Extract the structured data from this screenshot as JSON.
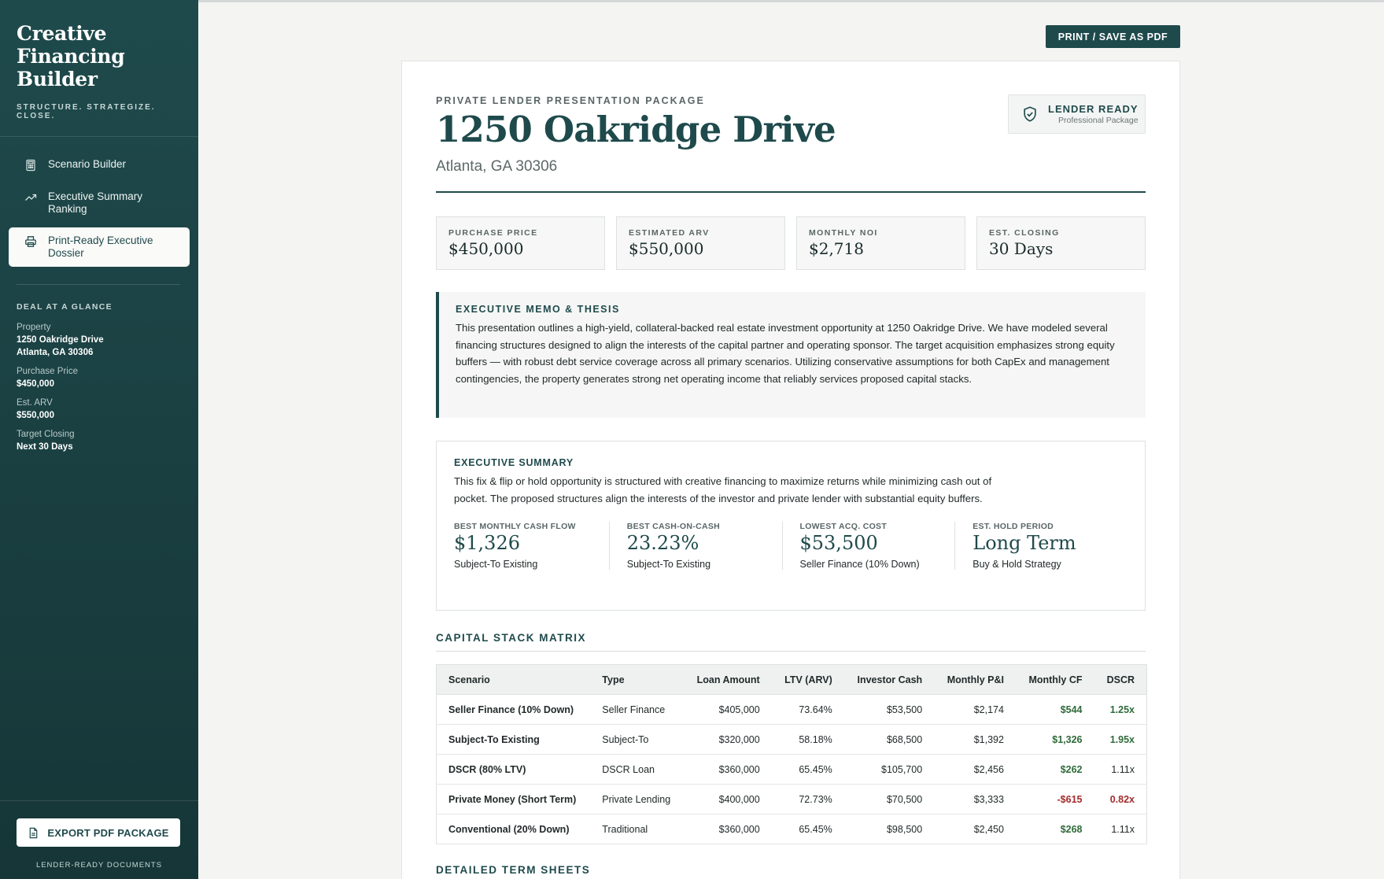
{
  "sidebar": {
    "brand_title": "Creative\nFinancing\nBuilder",
    "brand_tagline": "STRUCTURE. STRATEGIZE. CLOSE.",
    "nav": [
      {
        "label": "Scenario Builder",
        "icon": "calculator-icon"
      },
      {
        "label": "Executive Summary Ranking",
        "icon": "trending-up-icon"
      },
      {
        "label": "Print-Ready Executive Dossier",
        "icon": "printer-icon",
        "active": true
      }
    ],
    "glance_title": "DEAL AT A GLANCE",
    "glance": {
      "property_label": "Property",
      "property_line1": "1250 Oakridge Drive",
      "property_line2": "Atlanta, GA 30306",
      "price_label": "Purchase Price",
      "price_value": "$450,000",
      "arv_label": "Est. ARV",
      "arv_value": "$550,000",
      "closing_label": "Target Closing",
      "closing_value": "Next 30 Days"
    },
    "export_label": "EXPORT PDF PACKAGE",
    "footer_tag": "LENDER-READY DOCUMENTS"
  },
  "toolbar": {
    "print_label": "PRINT / SAVE AS PDF"
  },
  "header": {
    "eyebrow": "PRIVATE LENDER PRESENTATION PACKAGE",
    "title": "1250 Oakridge Drive",
    "subtitle": "Atlanta, GA 30306",
    "badge_title": "LENDER READY",
    "badge_sub": "Professional Package"
  },
  "stats": [
    {
      "label": "PURCHASE PRICE",
      "value": "$450,000"
    },
    {
      "label": "ESTIMATED ARV",
      "value": "$550,000"
    },
    {
      "label": "MONTHLY NOI",
      "value": "$2,718"
    },
    {
      "label": "EST. CLOSING",
      "value": "30 Days"
    }
  ],
  "memo": {
    "title": "EXECUTIVE MEMO & THESIS",
    "body": "This presentation outlines a high-yield, collateral-backed real estate investment opportunity at 1250 Oakridge Drive. We have modeled several financing structures designed to align the interests of the capital partner and operating sponsor. The target acquisition emphasizes strong equity buffers — with robust debt service coverage across all primary scenarios. Utilizing conservative assumptions for both CapEx and management contingencies, the property generates strong net operating income that reliably services proposed capital stacks."
  },
  "summary": {
    "title": "EXECUTIVE SUMMARY",
    "body": "This fix & flip or hold opportunity is structured with creative financing to maximize returns while minimizing cash out of pocket. The proposed structures align the interests of the investor and private lender with substantial equity buffers.",
    "metrics": [
      {
        "label": "BEST MONTHLY CASH FLOW",
        "value": "$1,326",
        "sub": "Subject-To Existing"
      },
      {
        "label": "BEST CASH-ON-CASH",
        "value": "23.23%",
        "sub": "Subject-To Existing"
      },
      {
        "label": "LOWEST ACQ. COST",
        "value": "$53,500",
        "sub": "Seller Finance (10% Down)"
      },
      {
        "label": "EST. HOLD PERIOD",
        "value": "Long Term",
        "sub": "Buy & Hold Strategy"
      }
    ]
  },
  "capital_stack": {
    "title": "CAPITAL STACK MATRIX",
    "headers": [
      "Scenario",
      "Type",
      "Loan Amount",
      "LTV (ARV)",
      "Investor Cash",
      "Monthly P&I",
      "Monthly CF",
      "DSCR"
    ],
    "rows": [
      {
        "scenario": "Seller Finance (10% Down)",
        "type": "Seller Finance",
        "loan": "$405,000",
        "ltv": "73.64%",
        "cash": "$53,500",
        "pi": "$2,174",
        "cf": "$544",
        "dscr": "1.25x",
        "cf_status": "pos",
        "dscr_status": "pos"
      },
      {
        "scenario": "Subject-To Existing",
        "type": "Subject-To",
        "loan": "$320,000",
        "ltv": "58.18%",
        "cash": "$68,500",
        "pi": "$1,392",
        "cf": "$1,326",
        "dscr": "1.95x",
        "cf_status": "pos",
        "dscr_status": "pos"
      },
      {
        "scenario": "DSCR (80% LTV)",
        "type": "DSCR Loan",
        "loan": "$360,000",
        "ltv": "65.45%",
        "cash": "$105,700",
        "pi": "$2,456",
        "cf": "$262",
        "dscr": "1.11x",
        "cf_status": "pos",
        "dscr_status": "plain"
      },
      {
        "scenario": "Private Money (Short Term)",
        "type": "Private Lending",
        "loan": "$400,000",
        "ltv": "72.73%",
        "cash": "$70,500",
        "pi": "$3,333",
        "cf": "-$615",
        "dscr": "0.82x",
        "cf_status": "neg",
        "dscr_status": "neg"
      },
      {
        "scenario": "Conventional (20% Down)",
        "type": "Traditional",
        "loan": "$360,000",
        "ltv": "65.45%",
        "cash": "$98,500",
        "pi": "$2,450",
        "cf": "$268",
        "dscr": "1.11x",
        "cf_status": "pos",
        "dscr_status": "plain"
      }
    ]
  },
  "term_sheets_title": "DETAILED TERM SHEETS",
  "colors": {
    "accent": "#1f4a4c",
    "positive": "#2f6b3a",
    "negative": "#a32d2d"
  }
}
